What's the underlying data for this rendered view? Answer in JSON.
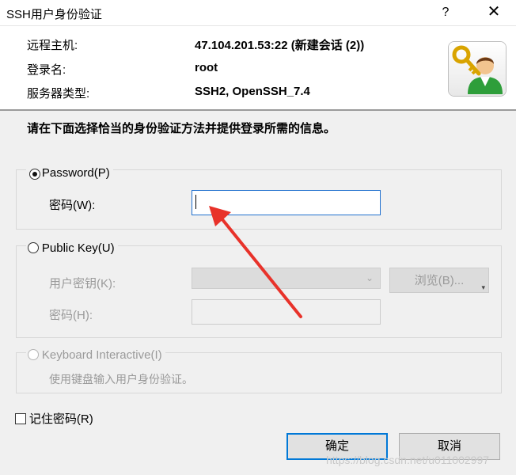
{
  "window": {
    "title": "SSH用户身份验证",
    "help_glyph": "?",
    "close_glyph": "✕"
  },
  "info": {
    "host_label": "远程主机:",
    "host_value": "47.104.201.53:22 (新建会话 (2))",
    "user_label": "登录名:",
    "user_value": "root",
    "server_label": "服务器类型:",
    "server_value": "SSH2, OpenSSH_7.4"
  },
  "instruction": "请在下面选择恰当的身份验证方法并提供登录所需的信息。",
  "password_group": {
    "option_label": "Password(P)",
    "selected": true,
    "field_label": "密码(W):",
    "field_value": ""
  },
  "pubkey_group": {
    "option_label": "Public Key(U)",
    "selected": false,
    "key_label": "用户密钥(K):",
    "key_value": "",
    "browse_label": "浏览(B)...",
    "passphrase_label": "密码(H):",
    "passphrase_value": ""
  },
  "keyboard_group": {
    "option_label": "Keyboard Interactive(I)",
    "selected": false,
    "description": "使用键盘输入用户身份验证。"
  },
  "remember": {
    "label": "记住密码(R)",
    "checked": false
  },
  "buttons": {
    "ok": "确定",
    "cancel": "取消"
  },
  "watermark": "https://blog.csdn.net/u011002997",
  "colors": {
    "accent_focus": "#1f6fce",
    "annotation_arrow": "#e8322a",
    "dialog_bg": "#f0f0f0"
  },
  "icons": [
    "key-user-logo-icon",
    "close-icon",
    "help-icon",
    "red-arrow-annotation-icon"
  ]
}
